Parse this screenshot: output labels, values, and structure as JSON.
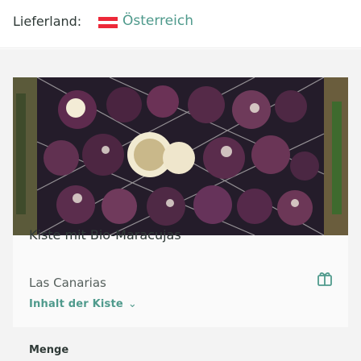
{
  "header": {
    "delivery_label": "Lieferland:",
    "country_flag_icon": "austria-flag-icon",
    "country": "Österreich",
    "flag_colors": [
      "#ed2939",
      "#ffffff",
      "#ed2939"
    ]
  },
  "product": {
    "image_icon": "passion-fruit-crate-photo",
    "title": "Kiste mit Bio-Maracujas",
    "origin": "Las Canarias",
    "contents_link": "Inhalt der Kiste",
    "contents_chevron": "chevron-down-icon",
    "gift_icon": "gift-icon"
  },
  "order": {
    "quantity_label": "Menge"
  },
  "colors": {
    "accent": "#4f9a8c",
    "text": "#2f3a37",
    "background": "#f3f3f3"
  }
}
